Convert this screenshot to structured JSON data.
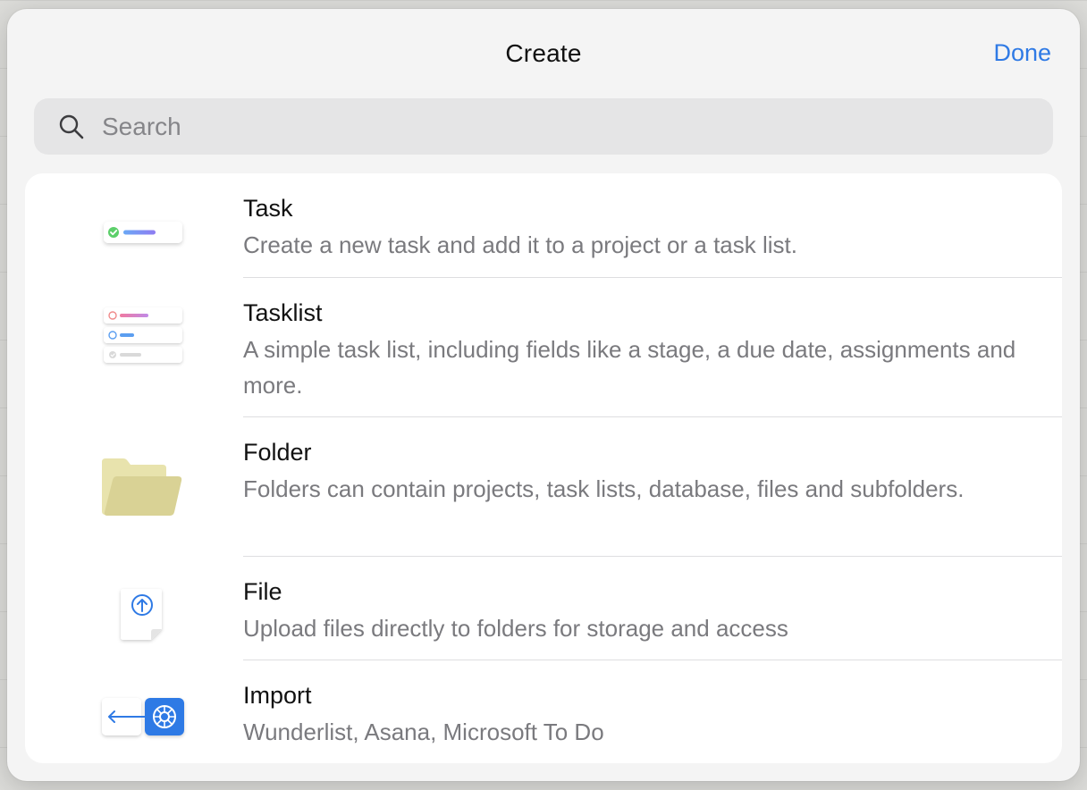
{
  "header": {
    "title": "Create",
    "done_label": "Done"
  },
  "search": {
    "placeholder": "Search",
    "value": ""
  },
  "items": [
    {
      "name": "Task",
      "description": "Create a new task and add it to a project or a task list.",
      "icon": "task-card-icon"
    },
    {
      "name": "Tasklist",
      "description": "A simple task list, including fields like a stage, a due date, assignments and more.",
      "icon": "tasklist-icon"
    },
    {
      "name": "Folder",
      "description": "Folders can contain projects, task lists, database, files and subfolders.",
      "icon": "folder-icon"
    },
    {
      "name": "File",
      "description": "Upload files directly to folders for storage and access",
      "icon": "file-upload-icon"
    },
    {
      "name": "Import",
      "description": "Wunderlist, Asana, Microsoft To Do",
      "icon": "import-icon"
    }
  ],
  "colors": {
    "accent": "#2f7ae5",
    "folder": "#ddd699",
    "check_green": "#5ccf6a"
  }
}
